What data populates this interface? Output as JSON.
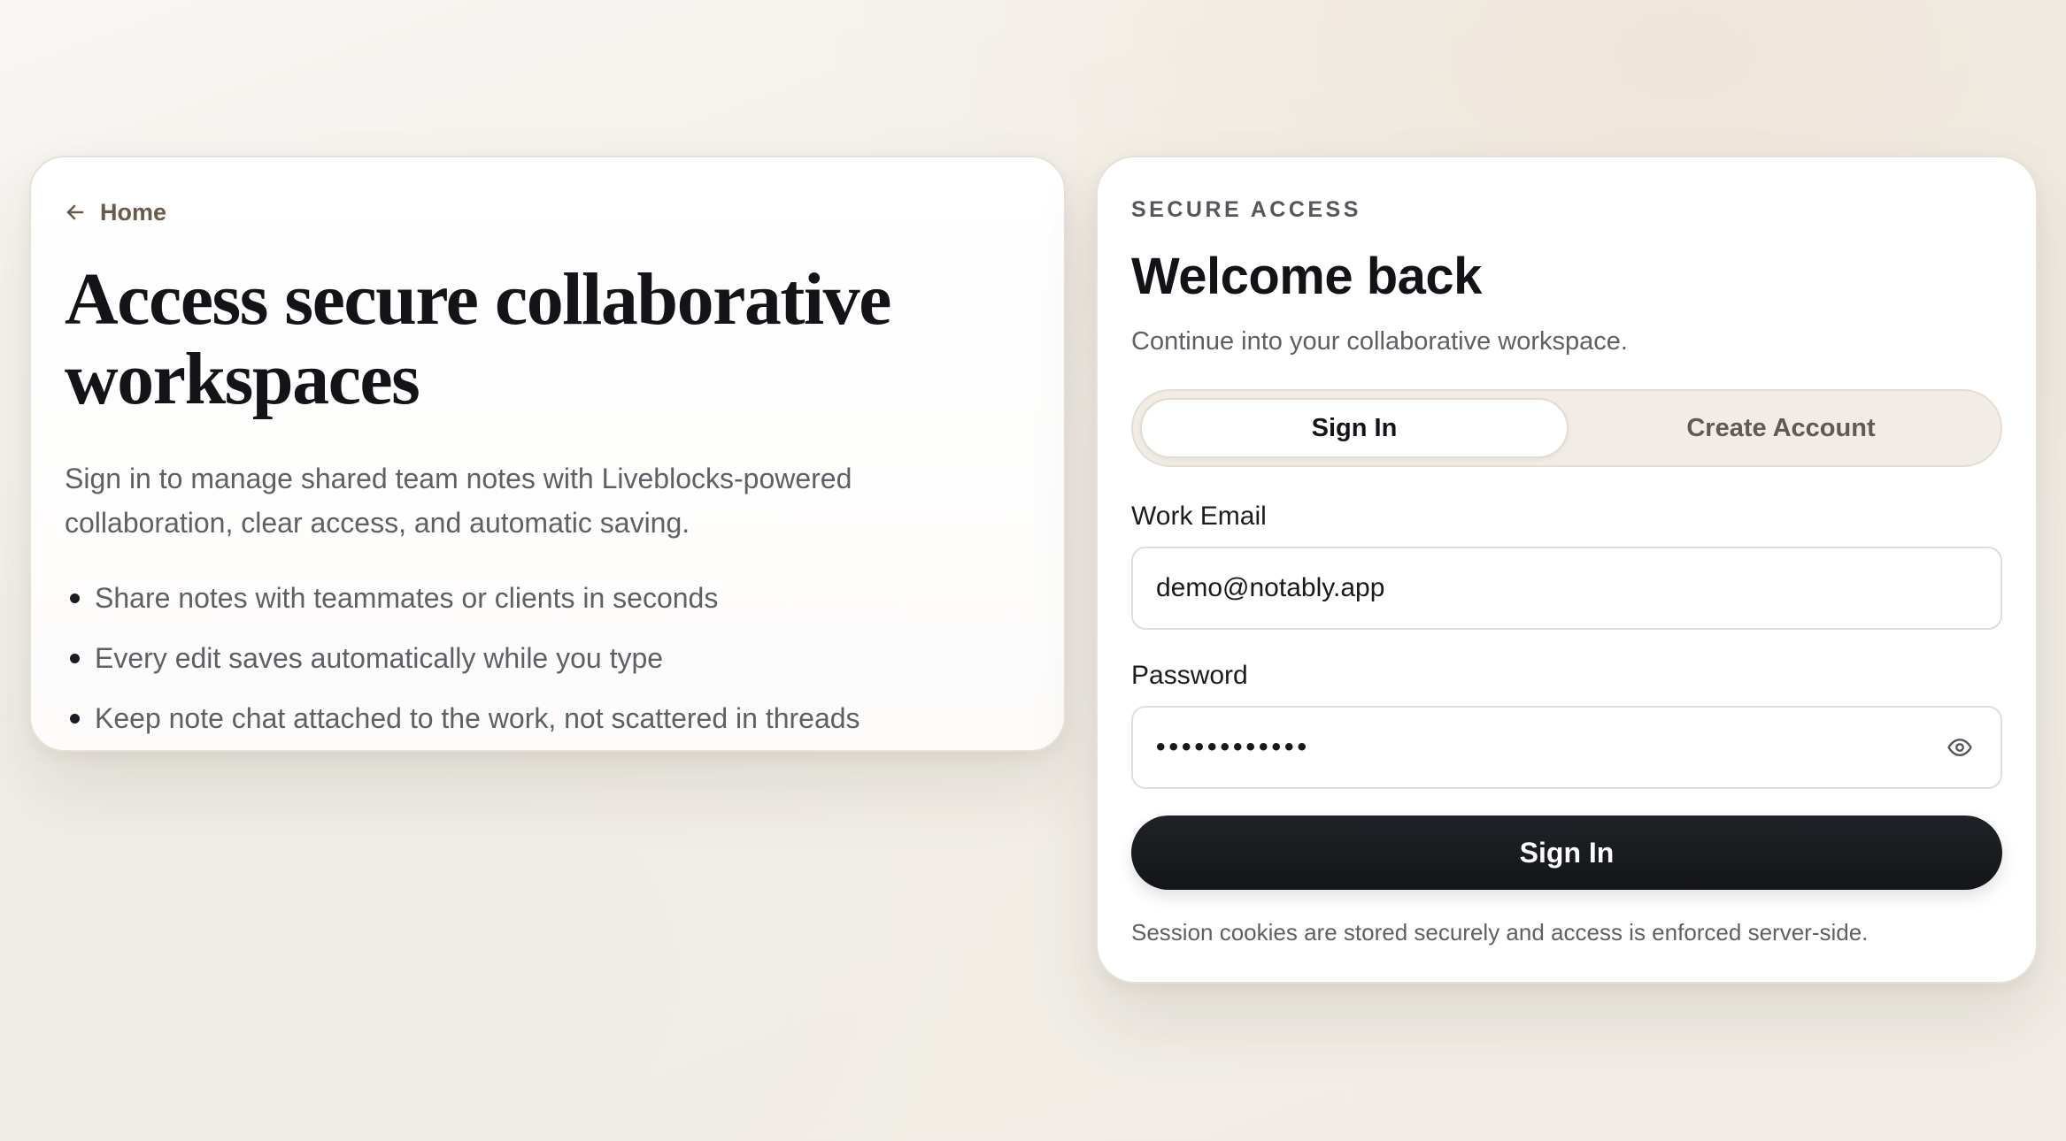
{
  "intro": {
    "home_label": "Home",
    "title": "Access secure collaborative workspaces",
    "description": "Sign in to manage shared team notes with Liveblocks-powered collaboration, clear access, and automatic saving.",
    "features": [
      "Share notes with teammates or clients in seconds",
      "Every edit saves automatically while you type",
      "Keep note chat attached to the work, not scattered in threads"
    ]
  },
  "auth": {
    "eyebrow": "SECURE ACCESS",
    "title": "Welcome back",
    "subtitle": "Continue into your collaborative workspace.",
    "tabs": [
      {
        "label": "Sign In",
        "active": true
      },
      {
        "label": "Create Account",
        "active": false
      }
    ],
    "email": {
      "label": "Work Email",
      "value": "demo@notably.app"
    },
    "password": {
      "label": "Password",
      "masked_value": "••••••••••••",
      "toggle_icon": "eye-icon"
    },
    "submit_label": "Sign In",
    "footnote": "Session cookies are stored securely and access is enforced server-side."
  },
  "icons": {
    "back": "arrow-left-icon",
    "password_toggle": "eye-icon"
  },
  "colors": {
    "accent_dark": "#16181c",
    "home_link": "#6a5a48",
    "segment_bg": "#f1ede6"
  }
}
